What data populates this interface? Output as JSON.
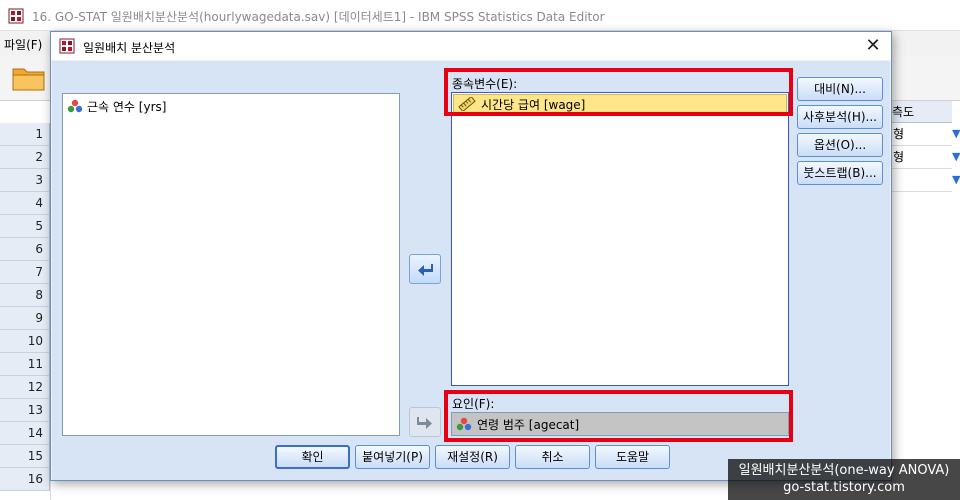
{
  "window": {
    "title": "16. GO-STAT 일원배치분산분석(hourlywagedata.sav) [데이터세트1] - IBM SPSS Statistics Data Editor",
    "menu_file": "파일(F)"
  },
  "grid": {
    "row_numbers": [
      "1",
      "2",
      "3",
      "4",
      "5",
      "6",
      "7",
      "8",
      "9",
      "10",
      "11",
      "12",
      "13",
      "14",
      "15",
      "16"
    ],
    "right_column_header": "측도",
    "right_cells": [
      "형",
      "형"
    ]
  },
  "dialog": {
    "title": "일원배치 분산분석",
    "source_variables": [
      {
        "label": "근속 연수 [yrs]",
        "icon": "nominal-variable-icon"
      }
    ],
    "dependent_label": "종속변수(E):",
    "dependent_variables": [
      {
        "label": "시간당 급여 [wage]",
        "icon": "ruler-scale-icon"
      }
    ],
    "factor_label": "요인(F):",
    "factor_variable": {
      "label": "연령 범주 [agecat]",
      "icon": "nominal-variable-icon"
    },
    "side_buttons": {
      "contrasts": "대비(N)...",
      "post_hoc": "사후분석(H)...",
      "options": "옵션(O)...",
      "bootstrap": "붓스트랩(B)..."
    },
    "bottom_buttons": {
      "ok": "확인",
      "paste": "붙여넣기(P)",
      "reset": "재설정(R)",
      "cancel": "취소",
      "help": "도움말"
    }
  },
  "watermark": {
    "line1": "일원배치분산분석(one-way ANOVA)",
    "line2": "go-stat.tistory.com"
  },
  "colors": {
    "highlight_frame": "#e60012",
    "dialog_body": "#d6e4f5",
    "selected_item": "#ffe68a"
  }
}
